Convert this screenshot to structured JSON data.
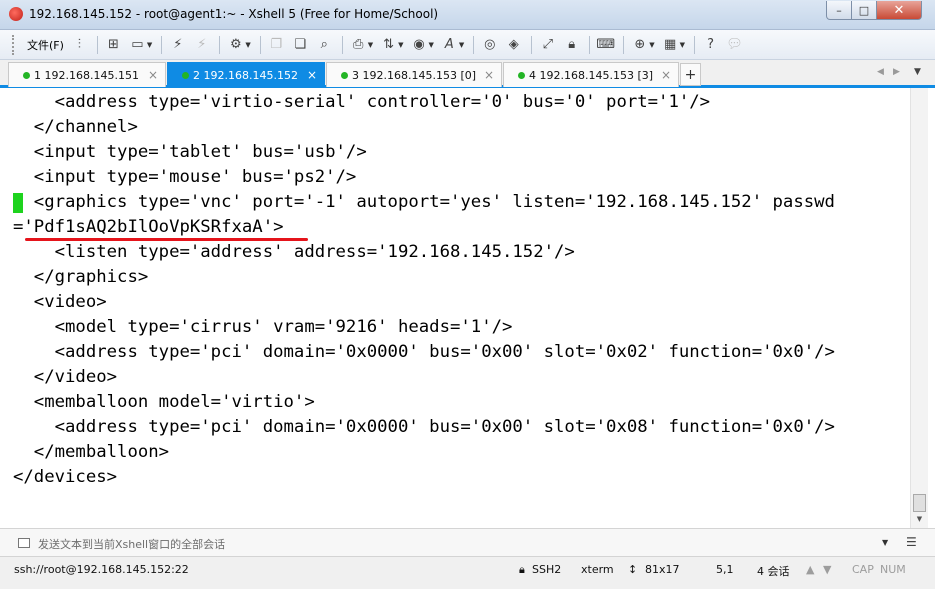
{
  "window": {
    "title": "192.168.145.152 - root@agent1:~ - Xshell 5 (Free for Home/School)",
    "min_label": "–",
    "max_label": "□",
    "close_label": "✕"
  },
  "toolbar": {
    "file_menu": "文件(F)",
    "icons": [
      "pin-icon",
      "new-session-icon",
      "open-folder-icon",
      "reconnect-icon",
      "disconnect-icon",
      "properties-icon",
      "copy-icon",
      "paste-icon",
      "find-icon",
      "print-icon",
      "transfer-icon",
      "globe-icon",
      "font-icon",
      "xftp-icon",
      "script-icon",
      "fullscreen-icon",
      "lock-icon",
      "keyboard-icon",
      "add-icon",
      "layout-icon",
      "help-icon",
      "chat-icon"
    ]
  },
  "tabs": [
    {
      "label": "1 192.168.145.151",
      "active": false
    },
    {
      "label": "2 192.168.145.152",
      "active": true
    },
    {
      "label": "3 192.168.145.153 [0]",
      "active": false
    },
    {
      "label": "4 192.168.145.153 [3]",
      "active": false
    }
  ],
  "tab_close": "×",
  "tab_add": "+",
  "terminal": {
    "lines": [
      "    <address type='virtio-serial' controller='0' bus='0' port='1'/>",
      "  </channel>",
      "  <input type='tablet' bus='usb'/>",
      "  <input type='mouse' bus='ps2'/>",
      "  <graphics type='vnc' port='-1' autoport='yes' listen='192.168.145.152' passwd",
      "='Pdf1sAQ2bIlOoVpKSRfxaA'>",
      "    <listen type='address' address='192.168.145.152'/>",
      "  </graphics>",
      "  <video>",
      "    <model type='cirrus' vram='9216' heads='1'/>",
      "    <address type='pci' domain='0x0000' bus='0x00' slot='0x02' function='0x0'/>",
      "  </video>",
      "  <memballoon model='virtio'>",
      "    <address type='pci' domain='0x0000' bus='0x00' slot='0x08' function='0x0'/>",
      "  </memballoon>",
      "</devices>"
    ]
  },
  "compose": {
    "placeholder": "发送文本到当前Xshell窗口的全部会话"
  },
  "status": {
    "connection": "ssh://root@192.168.145.152:22",
    "protocol": "SSH2",
    "terminal_type": "xterm",
    "size": "81x17",
    "cursor_pos": "5,1",
    "sessions": "4 会话",
    "caps": "CAP",
    "num": "NUM"
  },
  "colors": {
    "accent": "#0f8be4",
    "cursor": "#1ed31e",
    "highlight_underline": "#e5141b",
    "session_dot": "#23b425"
  }
}
